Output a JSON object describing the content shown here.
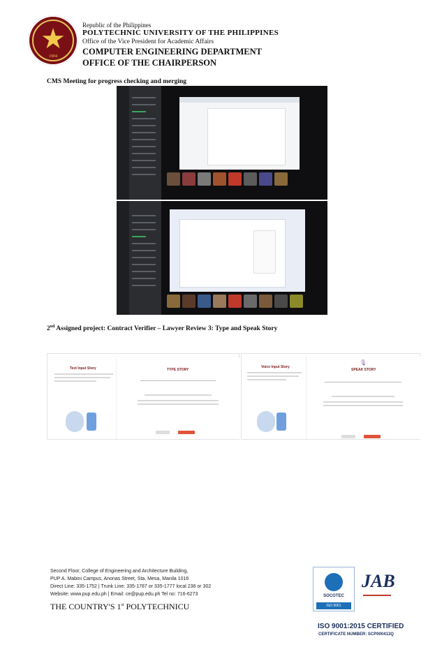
{
  "header": {
    "country": "Republic of the Philippines",
    "university": "POLYTECHNIC UNIVERSITY OF THE PHILIPPINES",
    "office_vp": "Office of the Vice President for Academic Affairs",
    "department": "COMPUTER ENGINEERING DEPARTMENT",
    "office": "OFFICE OF THE CHAIRPERSON",
    "seal_year": "1904"
  },
  "section1": {
    "title": "CMS Meeting for progress checking and merging"
  },
  "section2": {
    "title_num": "2",
    "title_sup": "nd",
    "title_rest": " Assigned project: Contract Verifier – Lawyer Review 3: Type and Speak Story"
  },
  "panels": {
    "text_input": "Text Input Story",
    "type_story": "TYPE STORY",
    "voice_input": "Voice Input Story",
    "speak_story": "SPEAK STORY"
  },
  "footer": {
    "address1": "Second Floor, College of Engineering and Architecture Building,",
    "address2": "PUP A. Mabini Campus, Anonas Street, Sta. Mesa, Manila 1016",
    "phones": "Direct Line: 335-1752 | Trunk Line: 335-1787 or 335-1777 local 236 or 302",
    "web": "Website: www.pup.edu.ph | Email: ce@pup.edu.ph Tel no: 716-6273",
    "tagline_a": "THE COUNTRY'S 1",
    "tagline_sup": "st",
    "tagline_b": " POLYTECHNICU",
    "cert_org": "SOCOTEC",
    "cert_iso": "ISO 9001",
    "cert_title": "ISO 9001:2015 CERTIFIED",
    "cert_number": "CERTIFICATE NUMBER: SCP000413Q"
  }
}
